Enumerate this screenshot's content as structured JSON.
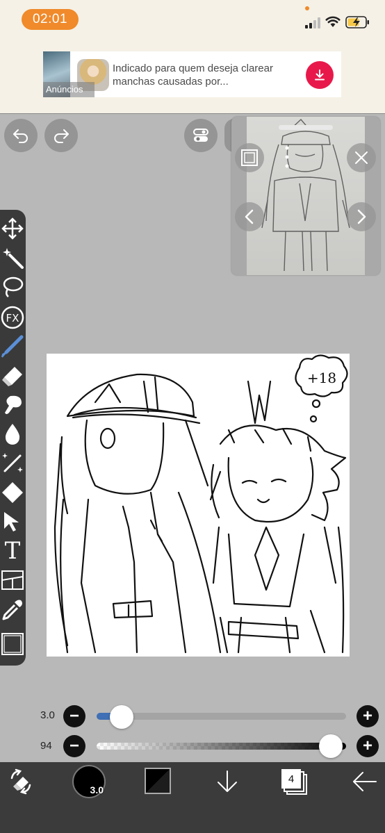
{
  "status_bar": {
    "time": "02:01",
    "colors": {
      "time_pill": "#f08a2a",
      "battery_charge": "#f7c948"
    },
    "icons": [
      "cellular-signal-icon",
      "wifi-icon",
      "battery-charging-icon"
    ]
  },
  "ad": {
    "label": "Anúncios",
    "text": "Indicado para quem deseja clarear manchas causadas por...",
    "download_color": "#e8194a"
  },
  "top_controls": {
    "icons": [
      "undo-icon",
      "redo-icon",
      "settings-toggle-icon"
    ]
  },
  "reference_window": {
    "icons": [
      "layer-frame-icon",
      "more-vertical-icon",
      "close-icon",
      "previous-icon",
      "next-icon"
    ]
  },
  "toolbar": {
    "tools": [
      "move-icon",
      "magic-wand-icon",
      "lasso-icon",
      "fx-icon",
      "brush-icon",
      "eraser-icon",
      "smudge-icon",
      "blur-drop-icon",
      "special-brush-icon",
      "fill-icon",
      "select-pointer-icon",
      "text-icon",
      "frame-divider-icon",
      "eyedropper-icon",
      "canvas-icon"
    ],
    "fx_label": "FX",
    "text_tool_label": "T",
    "active_tool": "brush-icon"
  },
  "canvas": {
    "thought_bubble_text": "+18"
  },
  "brush_size": {
    "label": "3.0",
    "value": 3.0,
    "fraction": 0.1,
    "accent": "#3f6fb5"
  },
  "brush_opacity": {
    "label": "94",
    "value": 94,
    "fraction": 0.94
  },
  "bottom_bar": {
    "brush_size_badge": "3.0",
    "layer_count": "4",
    "primary_color": "#000000",
    "icons": [
      "transform-tools-icon",
      "brush-preview-icon",
      "color-swatch-icon",
      "download-arrow-icon",
      "layers-icon",
      "back-arrow-icon"
    ]
  }
}
